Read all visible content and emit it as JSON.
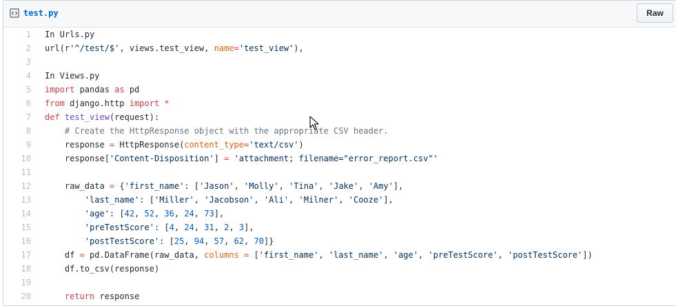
{
  "file": {
    "name": "test.py",
    "raw_label": "Raw",
    "icon": "code-file-icon"
  },
  "code_lines": [
    {
      "n": "1",
      "tokens": [
        [
          "t",
          "In Urls.py"
        ]
      ]
    },
    {
      "n": "2",
      "tokens": [
        [
          "t",
          "url("
        ],
        [
          "s",
          "r'^/test/$'"
        ],
        [
          "t",
          ", views.test_view, "
        ],
        [
          "p",
          "name"
        ],
        [
          "k",
          "="
        ],
        [
          "s",
          "'test_view'"
        ],
        [
          "t",
          "),"
        ]
      ]
    },
    {
      "n": "3",
      "tokens": []
    },
    {
      "n": "4",
      "tokens": [
        [
          "t",
          "In Views.py"
        ]
      ]
    },
    {
      "n": "5",
      "tokens": [
        [
          "k",
          "import"
        ],
        [
          "t",
          " pandas "
        ],
        [
          "k",
          "as"
        ],
        [
          "t",
          " pd"
        ]
      ]
    },
    {
      "n": "6",
      "tokens": [
        [
          "k",
          "from"
        ],
        [
          "t",
          " django.http "
        ],
        [
          "k",
          "import"
        ],
        [
          "t",
          " "
        ],
        [
          "k",
          "*"
        ]
      ]
    },
    {
      "n": "7",
      "tokens": [
        [
          "k",
          "def"
        ],
        [
          "t",
          " "
        ],
        [
          "f",
          "test_view"
        ],
        [
          "t",
          "(request):"
        ]
      ]
    },
    {
      "n": "8",
      "tokens": [
        [
          "t",
          "    "
        ],
        [
          "c",
          "# Create the HttpResponse object with the appropriate CSV header."
        ]
      ]
    },
    {
      "n": "9",
      "tokens": [
        [
          "t",
          "    response "
        ],
        [
          "k",
          "="
        ],
        [
          "t",
          " HttpResponse("
        ],
        [
          "p",
          "content_type"
        ],
        [
          "k",
          "="
        ],
        [
          "s",
          "'text/csv'"
        ],
        [
          "t",
          ")"
        ]
      ]
    },
    {
      "n": "10",
      "tokens": [
        [
          "t",
          "    response["
        ],
        [
          "s",
          "'Content-Disposition'"
        ],
        [
          "t",
          "] "
        ],
        [
          "k",
          "="
        ],
        [
          "t",
          " "
        ],
        [
          "s",
          "'attachment; filename=\"error_report.csv\"'"
        ]
      ]
    },
    {
      "n": "11",
      "tokens": []
    },
    {
      "n": "12",
      "tokens": [
        [
          "t",
          "    raw_data "
        ],
        [
          "k",
          "="
        ],
        [
          "t",
          " {"
        ],
        [
          "s",
          "'first_name'"
        ],
        [
          "t",
          ": ["
        ],
        [
          "s",
          "'Jason'"
        ],
        [
          "t",
          ", "
        ],
        [
          "s",
          "'Molly'"
        ],
        [
          "t",
          ", "
        ],
        [
          "s",
          "'Tina'"
        ],
        [
          "t",
          ", "
        ],
        [
          "s",
          "'Jake'"
        ],
        [
          "t",
          ", "
        ],
        [
          "s",
          "'Amy'"
        ],
        [
          "t",
          "],"
        ]
      ]
    },
    {
      "n": "13",
      "tokens": [
        [
          "t",
          "        "
        ],
        [
          "s",
          "'last_name'"
        ],
        [
          "t",
          ": ["
        ],
        [
          "s",
          "'Miller'"
        ],
        [
          "t",
          ", "
        ],
        [
          "s",
          "'Jacobson'"
        ],
        [
          "t",
          ", "
        ],
        [
          "s",
          "'Ali'"
        ],
        [
          "t",
          ", "
        ],
        [
          "s",
          "'Milner'"
        ],
        [
          "t",
          ", "
        ],
        [
          "s",
          "'Cooze'"
        ],
        [
          "t",
          "],"
        ]
      ]
    },
    {
      "n": "14",
      "tokens": [
        [
          "t",
          "        "
        ],
        [
          "s",
          "'age'"
        ],
        [
          "t",
          ": ["
        ],
        [
          "n",
          "42"
        ],
        [
          "t",
          ", "
        ],
        [
          "n",
          "52"
        ],
        [
          "t",
          ", "
        ],
        [
          "n",
          "36"
        ],
        [
          "t",
          ", "
        ],
        [
          "n",
          "24"
        ],
        [
          "t",
          ", "
        ],
        [
          "n",
          "73"
        ],
        [
          "t",
          "],"
        ]
      ]
    },
    {
      "n": "15",
      "tokens": [
        [
          "t",
          "        "
        ],
        [
          "s",
          "'preTestScore'"
        ],
        [
          "t",
          ": ["
        ],
        [
          "n",
          "4"
        ],
        [
          "t",
          ", "
        ],
        [
          "n",
          "24"
        ],
        [
          "t",
          ", "
        ],
        [
          "n",
          "31"
        ],
        [
          "t",
          ", "
        ],
        [
          "n",
          "2"
        ],
        [
          "t",
          ", "
        ],
        [
          "n",
          "3"
        ],
        [
          "t",
          "],"
        ]
      ]
    },
    {
      "n": "16",
      "tokens": [
        [
          "t",
          "        "
        ],
        [
          "s",
          "'postTestScore'"
        ],
        [
          "t",
          ": ["
        ],
        [
          "n",
          "25"
        ],
        [
          "t",
          ", "
        ],
        [
          "n",
          "94"
        ],
        [
          "t",
          ", "
        ],
        [
          "n",
          "57"
        ],
        [
          "t",
          ", "
        ],
        [
          "n",
          "62"
        ],
        [
          "t",
          ", "
        ],
        [
          "n",
          "70"
        ],
        [
          "t",
          "]}"
        ]
      ]
    },
    {
      "n": "17",
      "tokens": [
        [
          "t",
          "    df "
        ],
        [
          "k",
          "="
        ],
        [
          "t",
          " pd.DataFrame(raw_data, "
        ],
        [
          "p",
          "columns"
        ],
        [
          "t",
          " "
        ],
        [
          "k",
          "="
        ],
        [
          "t",
          " ["
        ],
        [
          "s",
          "'first_name'"
        ],
        [
          "t",
          ", "
        ],
        [
          "s",
          "'last_name'"
        ],
        [
          "t",
          ", "
        ],
        [
          "s",
          "'age'"
        ],
        [
          "t",
          ", "
        ],
        [
          "s",
          "'preTestScore'"
        ],
        [
          "t",
          ", "
        ],
        [
          "s",
          "'postTestScore'"
        ],
        [
          "t",
          "])"
        ]
      ]
    },
    {
      "n": "18",
      "tokens": [
        [
          "t",
          "    df.to_csv(response)"
        ]
      ]
    },
    {
      "n": "19",
      "tokens": []
    },
    {
      "n": "20",
      "tokens": [
        [
          "t",
          "    "
        ],
        [
          "k",
          "return"
        ],
        [
          "t",
          " response"
        ]
      ]
    }
  ],
  "colors": {
    "keyword": "#d73a49",
    "string": "#032f62",
    "number": "#005cc5",
    "function": "#6f42c1",
    "comment": "#6a737d",
    "param": "#e36209",
    "link": "#0366d6"
  }
}
